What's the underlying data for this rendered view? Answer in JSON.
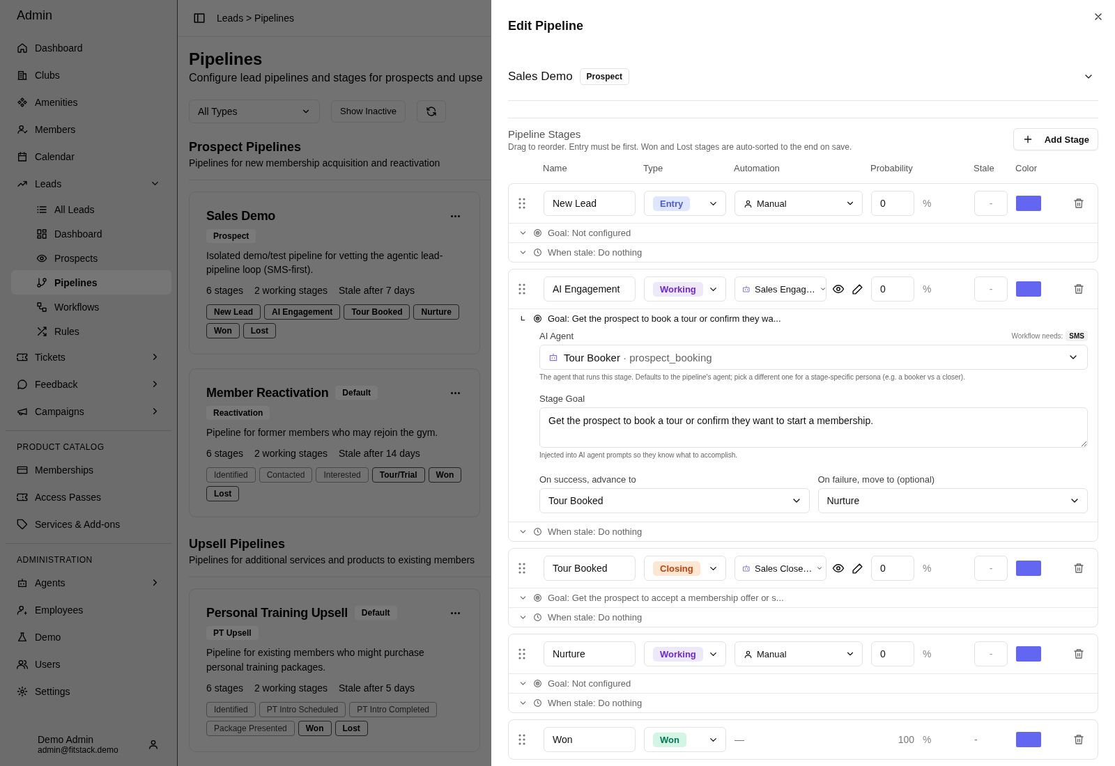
{
  "sidebar": {
    "title": "Admin",
    "nav": [
      {
        "label": "Dashboard",
        "selected": false
      },
      {
        "label": "Clubs",
        "selected": false
      },
      {
        "label": "Amenities",
        "selected": false
      },
      {
        "label": "Members",
        "selected": false
      },
      {
        "label": "Calendar",
        "selected": false
      },
      {
        "label": "Leads",
        "selected": false,
        "expanded": true,
        "children": [
          {
            "label": "All Leads",
            "selected": false
          },
          {
            "label": "Dashboard",
            "selected": false
          },
          {
            "label": "Prospects",
            "selected": false
          },
          {
            "label": "Pipelines",
            "selected": true
          },
          {
            "label": "Workflows",
            "selected": false
          },
          {
            "label": "Rules",
            "selected": false
          }
        ]
      },
      {
        "label": "Tickets",
        "selected": false,
        "expanded": false
      },
      {
        "label": "Feedback",
        "selected": false,
        "expanded": false
      },
      {
        "label": "Campaigns",
        "selected": false,
        "expanded": false
      }
    ],
    "sections": [
      {
        "heading": "PRODUCT CATALOG",
        "items": [
          {
            "label": "Memberships",
            "selected": false
          },
          {
            "label": "Access Passes",
            "selected": false
          },
          {
            "label": "Services & Add-ons",
            "selected": false
          }
        ]
      },
      {
        "heading": "ADMINISTRATION",
        "items": [
          {
            "label": "Agents",
            "selected": false,
            "expanded": false
          },
          {
            "label": "Employees",
            "selected": false
          },
          {
            "label": "Demo",
            "selected": false
          },
          {
            "label": "Users",
            "selected": false
          },
          {
            "label": "Settings",
            "selected": false
          }
        ]
      }
    ],
    "user": {
      "name": "Demo Admin",
      "email": "admin@fitstack.demo"
    }
  },
  "header": {
    "breadcrumb": "Leads > Pipelines"
  },
  "page": {
    "title": "Pipelines",
    "subtitle": "Configure lead pipelines and stages for prospects and upse",
    "filter": "All Types",
    "show_inactive": "Show Inactive"
  },
  "sections": [
    {
      "title": "Prospect Pipelines",
      "description": "Pipelines for new membership acquisition and reactivation",
      "cards": [
        {
          "title": "Sales Demo",
          "type_badge": "Prospect",
          "description": "Isolated demo/test pipeline for vetting the agentic lead-pipeline loop (SMS-first).",
          "stats": [
            "6 stages",
            "2 working stages",
            "Stale after 7 days"
          ],
          "stages": [
            {
              "label": "New Lead",
              "muted": false
            },
            {
              "label": "AI Engagement",
              "muted": false
            },
            {
              "label": "Tour Booked",
              "muted": false
            },
            {
              "label": "Nurture",
              "muted": false
            },
            {
              "label": "Won",
              "muted": false
            },
            {
              "label": "Lost",
              "muted": false
            }
          ]
        },
        {
          "title": "Member Reactivation",
          "default_badge": "Default",
          "type_badge": "Reactivation",
          "description": "Pipeline for former members who may rejoin the gym.",
          "stats": [
            "6 stages",
            "2 working stages",
            "Stale after 14 days"
          ],
          "stages": [
            {
              "label": "Identified",
              "muted": true
            },
            {
              "label": "Contacted",
              "muted": true
            },
            {
              "label": "Interested",
              "muted": true
            },
            {
              "label": "Tour/Trial",
              "muted": false
            },
            {
              "label": "Won",
              "muted": false
            },
            {
              "label": "Lost",
              "muted": false
            }
          ]
        }
      ]
    },
    {
      "title": "Upsell Pipelines",
      "description": "Pipelines for additional services and products to existing members",
      "cards": [
        {
          "title": "Personal Training Upsell",
          "default_badge": "Default",
          "type_badge": "PT Upsell",
          "description": "Pipeline for existing members who might purchase personal training packages.",
          "stats": [
            "6 stages",
            "2 working stages",
            "Stale after 5 days"
          ],
          "stages": [
            {
              "label": "Identified",
              "muted": true
            },
            {
              "label": "PT Intro Scheduled",
              "muted": true
            },
            {
              "label": "PT Intro Completed",
              "muted": true
            },
            {
              "label": "Package Presented",
              "muted": true
            },
            {
              "label": "Won",
              "muted": false
            },
            {
              "label": "Lost",
              "muted": false
            }
          ]
        }
      ]
    }
  ],
  "drawer": {
    "title": "Edit Pipeline",
    "pipeline": {
      "name": "Sales Demo",
      "type": "Prospect"
    },
    "stages_heading": "Pipeline Stages",
    "stages_hint": "Drag to reorder. Entry must be first. Won and Lost stages are auto-sorted to the end on save.",
    "add_button": "Add Stage",
    "columns": [
      "Name",
      "Type",
      "Automation",
      "Probability",
      "Stale",
      "Color"
    ],
    "stages": [
      {
        "kind": "standard",
        "name": "New Lead",
        "type": {
          "label": "Entry",
          "kind": "entry"
        },
        "automation": {
          "kind": "manual",
          "label": "Manual"
        },
        "probability": "0",
        "unit": "%",
        "stale": {
          "placeholder": "-"
        },
        "color": "#6366f1",
        "goal": {
          "text": "Goal: Not configured",
          "expanded": false
        },
        "stale_action": "When stale: Do nothing"
      },
      {
        "kind": "standard",
        "name": "AI Engagement",
        "type": {
          "label": "Working",
          "kind": "working"
        },
        "automation": {
          "kind": "agent",
          "label": "Sales Engag…"
        },
        "probability": "0",
        "unit": "%",
        "stale": {
          "placeholder": "-"
        },
        "color": "#6366f1",
        "goal": {
          "text": "Goal: Get the prospect to book a tour or confirm they wa...",
          "expanded": true,
          "detail": {
            "agent_label": "AI Agent",
            "needs_label": "Workflow needs:",
            "needs_badge": "SMS",
            "agent_name": "Tour Booker",
            "agent_id": "· prospect_booking",
            "agent_help": "The agent that runs this stage. Defaults to the pipeline's agent; pick a different one for a stage-specific persona (e.g. a booker vs a closer).",
            "goal_label": "Stage Goal",
            "goal_value": "Get the prospect to book a tour or confirm they want to start a membership.",
            "goal_help": "Injected into AI agent prompts so they know what to accomplish.",
            "success_label": "On success, advance to",
            "success_value": "Tour Booked",
            "failure_label": "On failure, move to (optional)",
            "failure_value": "Nurture"
          }
        },
        "stale_action": "When stale: Do nothing"
      },
      {
        "kind": "standard",
        "name": "Tour Booked",
        "type": {
          "label": "Closing",
          "kind": "closing"
        },
        "automation": {
          "kind": "agent",
          "label": "Sales Close…"
        },
        "probability": "0",
        "unit": "%",
        "stale": {
          "placeholder": "-"
        },
        "color": "#6366f1",
        "goal": {
          "text": "Goal: Get the prospect to accept a membership offer or s...",
          "expanded": false
        },
        "stale_action": "When stale: Do nothing"
      },
      {
        "kind": "standard",
        "name": "Nurture",
        "type": {
          "label": "Working",
          "kind": "working"
        },
        "automation": {
          "kind": "manual",
          "label": "Manual"
        },
        "probability": "0",
        "unit": "%",
        "stale": {
          "placeholder": "-"
        },
        "color": "#6366f1",
        "goal": {
          "text": "Goal: Not configured",
          "expanded": false
        },
        "stale_action": "When stale: Do nothing"
      },
      {
        "kind": "terminal",
        "name": "Won",
        "type": {
          "label": "Won",
          "kind": "won"
        },
        "automation": {
          "kind": "none",
          "label": "—"
        },
        "probability": "100",
        "unit": "%",
        "stale": "-",
        "color": "#6366f1"
      }
    ]
  }
}
